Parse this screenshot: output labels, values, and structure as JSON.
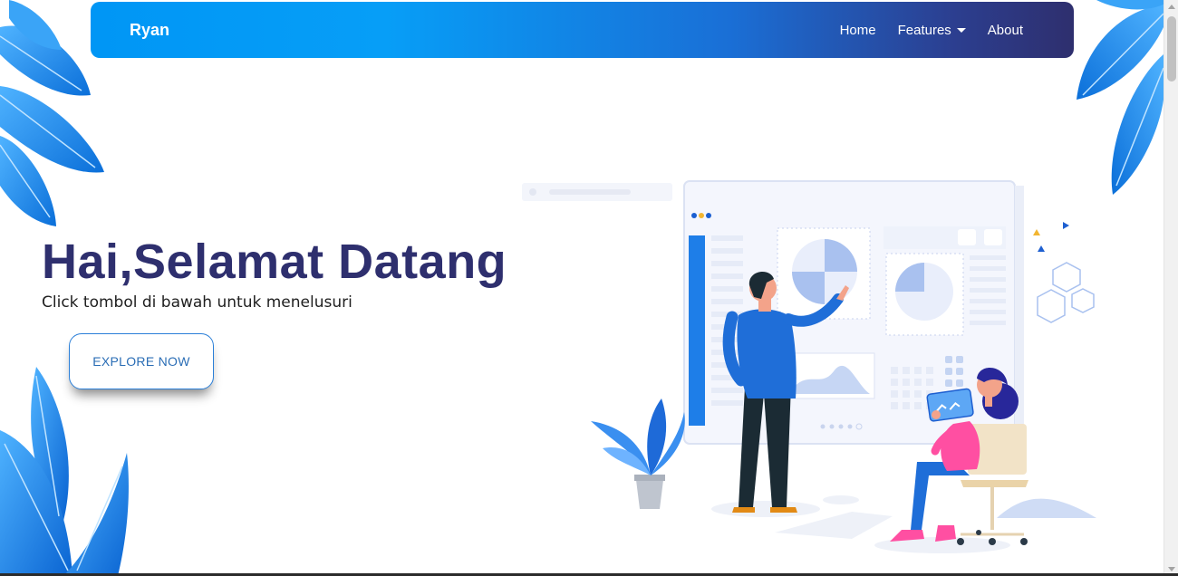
{
  "navbar": {
    "brand": "Ryan",
    "links": [
      {
        "label": "Home"
      },
      {
        "label": "Features"
      },
      {
        "label": "About"
      }
    ]
  },
  "hero": {
    "title": "Hai,Selamat Datang",
    "subtitle": "Click tombol di bawah untuk menelusuri",
    "cta_label": "EXPLORE NOW"
  },
  "colors": {
    "brand_dark": "#2e2f6e",
    "accent_blue": "#0096f5",
    "leaf_blue": "#1e8ff0"
  },
  "icons": [
    "leaf-decoration",
    "chevron-down-icon",
    "phone-icon",
    "chat-icon"
  ]
}
